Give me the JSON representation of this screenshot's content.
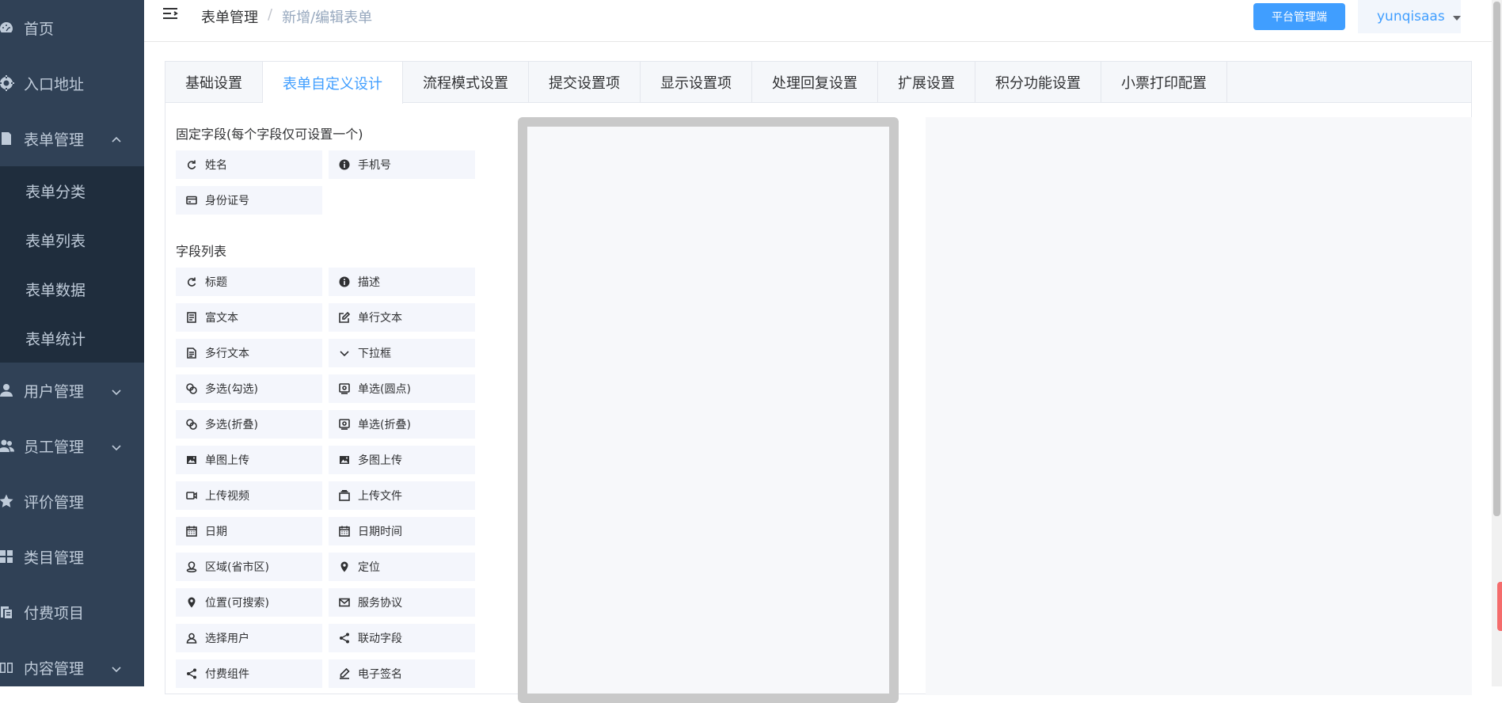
{
  "sidebar": {
    "items": [
      {
        "label": "首页",
        "icon": "dashboard-icon"
      },
      {
        "label": "入口地址",
        "icon": "entry-icon"
      },
      {
        "label": "表单管理",
        "icon": "form-icon",
        "expanded": true
      },
      {
        "label": "用户管理",
        "icon": "user-icon"
      },
      {
        "label": "员工管理",
        "icon": "staff-icon"
      },
      {
        "label": "评价管理",
        "icon": "star-icon"
      },
      {
        "label": "类目管理",
        "icon": "category-icon"
      },
      {
        "label": "付费项目",
        "icon": "paid-icon"
      },
      {
        "label": "内容管理",
        "icon": "book-icon"
      }
    ],
    "form_submenu": [
      "表单分类",
      "表单列表",
      "表单数据",
      "表单统计"
    ]
  },
  "header": {
    "breadcrumb": [
      "表单管理",
      "新增/编辑表单"
    ],
    "breadcrumb_sep": "/",
    "platform_button": "平台管理端",
    "username": "yunqisaas"
  },
  "tabs": [
    {
      "label": "基础设置",
      "active": false
    },
    {
      "label": "表单自定义设计",
      "active": true
    },
    {
      "label": "流程模式设置",
      "active": false
    },
    {
      "label": "提交设置项",
      "active": false
    },
    {
      "label": "显示设置项",
      "active": false
    },
    {
      "label": "处理回复设置",
      "active": false
    },
    {
      "label": "扩展设置",
      "active": false
    },
    {
      "label": "积分功能设置",
      "active": false
    },
    {
      "label": "小票打印配置",
      "active": false
    }
  ],
  "fixed_fields": {
    "title": "固定字段(每个字段仅可设置一个)",
    "items": [
      {
        "label": "姓名",
        "icon": "refresh-icon"
      },
      {
        "label": "手机号",
        "icon": "info-icon"
      },
      {
        "label": "身份证号",
        "icon": "idcard-icon"
      }
    ]
  },
  "field_list": {
    "title": "字段列表",
    "items": [
      {
        "label": "标题",
        "icon": "refresh-icon"
      },
      {
        "label": "描述",
        "icon": "info-icon"
      },
      {
        "label": "富文本",
        "icon": "richtext-icon"
      },
      {
        "label": "单行文本",
        "icon": "edit-icon"
      },
      {
        "label": "多行文本",
        "icon": "document-icon"
      },
      {
        "label": "下拉框",
        "icon": "chevron-down-icon"
      },
      {
        "label": "多选(勾选)",
        "icon": "multi-check-icon"
      },
      {
        "label": "单选(圆点)",
        "icon": "radio-icon"
      },
      {
        "label": "多选(折叠)",
        "icon": "multi-fold-icon"
      },
      {
        "label": "单选(折叠)",
        "icon": "radio-fold-icon"
      },
      {
        "label": "单图上传",
        "icon": "image-icon"
      },
      {
        "label": "多图上传",
        "icon": "images-icon"
      },
      {
        "label": "上传视频",
        "icon": "video-icon"
      },
      {
        "label": "上传文件",
        "icon": "file-icon"
      },
      {
        "label": "日期",
        "icon": "calendar-icon"
      },
      {
        "label": "日期时间",
        "icon": "calendar-time-icon"
      },
      {
        "label": "区域(省市区)",
        "icon": "region-icon"
      },
      {
        "label": "定位",
        "icon": "location-icon"
      },
      {
        "label": "位置(可搜索)",
        "icon": "location-search-icon"
      },
      {
        "label": "服务协议",
        "icon": "mail-icon"
      },
      {
        "label": "选择用户",
        "icon": "user-select-icon"
      },
      {
        "label": "联动字段",
        "icon": "share-icon"
      },
      {
        "label": "付费组件",
        "icon": "share-icon"
      },
      {
        "label": "电子签名",
        "icon": "signature-icon"
      }
    ]
  }
}
